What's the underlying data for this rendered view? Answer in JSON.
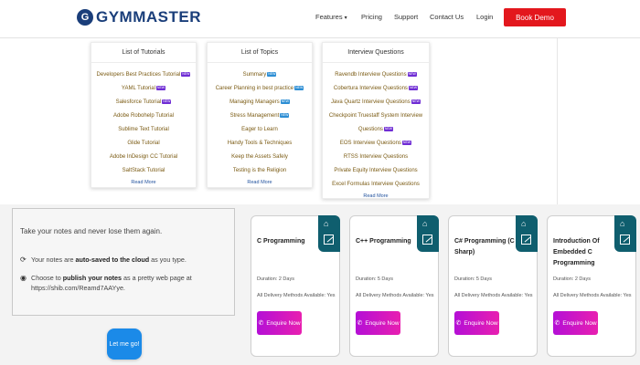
{
  "header": {
    "logo_mark": "G",
    "logo_text": "GYMMASTER",
    "nav": [
      "Features",
      "Pricing",
      "Support",
      "Contact Us",
      "Login"
    ],
    "book_demo": "Book Demo"
  },
  "columns": [
    {
      "title": "List of Tutorials",
      "items": [
        {
          "label": "Developers Best Practices Tutorial",
          "badge": "NEW"
        },
        {
          "label": "YAML Tutorial",
          "badge": "NEW"
        },
        {
          "label": "Salesforce Tutorial",
          "badge": "NEW"
        },
        {
          "label": "Adobe Robohelp Tutorial",
          "badge": ""
        },
        {
          "label": "Sublime Text Tutorial",
          "badge": ""
        },
        {
          "label": "Glide Tutorial",
          "badge": ""
        },
        {
          "label": "Adobe InDesign CC Tutorial",
          "badge": ""
        },
        {
          "label": "SaltStack Tutorial",
          "badge": ""
        }
      ],
      "read_more": "Read More"
    },
    {
      "title": "List of Topics",
      "items": [
        {
          "label": "Summary",
          "badge": "NEW"
        },
        {
          "label": "Career Planning in best practice",
          "badge": "NEW"
        },
        {
          "label": "Managing Managers",
          "badge": "NEW"
        },
        {
          "label": "Stress Management",
          "badge": "NEW"
        },
        {
          "label": "Eager to Learn",
          "badge": ""
        },
        {
          "label": "Handy Tools & Techniques",
          "badge": ""
        },
        {
          "label": "Keep the Assets Safely",
          "badge": ""
        },
        {
          "label": "Testing is the Religion",
          "badge": ""
        }
      ],
      "read_more": "Read More"
    },
    {
      "title": "Interview Questions",
      "items": [
        {
          "label": "Ravendb Interview Questions",
          "badge": "NEW"
        },
        {
          "label": "Cobertura Interview Questions",
          "badge": "NEW"
        },
        {
          "label": "Java Quartz Interview Questions",
          "badge": "NEW"
        },
        {
          "label": "Checkpoint Truestaff System Interview",
          "badge": ""
        },
        {
          "label": "Questions",
          "badge": "NEW"
        },
        {
          "label": "EOS Interview Questions",
          "badge": "NEW"
        },
        {
          "label": "RTSS Interview Questions",
          "badge": ""
        },
        {
          "label": "Private Equity Interview Questions",
          "badge": ""
        },
        {
          "label": "Excel Formulas Interview Questions",
          "badge": ""
        }
      ],
      "read_more": "Read More"
    }
  ],
  "notes": {
    "headline": "Take your notes and never lose them again.",
    "item1_pre": "Your notes are ",
    "item1_bold": "auto-saved to the cloud",
    "item1_post": " as you type.",
    "item2_pre": "Choose to ",
    "item2_bold": "publish your notes",
    "item2_post": " as a pretty web page at",
    "item2_line2": "https://shib.com/Reamd7AAYye.",
    "cta": "Let me go!"
  },
  "courses": [
    {
      "title": "C Programming",
      "duration": "Duration: 2 Days",
      "delivery": "All Delivery Methods Available: Yes",
      "cta": "Enquire Now"
    },
    {
      "title": "C++ Programming",
      "duration": "Duration: 5 Days",
      "delivery": "All Delivery Methods Available: Yes",
      "cta": "Enquire Now"
    },
    {
      "title": "C# Programming (C Sharp)",
      "duration": "Duration: 5 Days",
      "delivery": "All Delivery Methods Available: Yes",
      "cta": "Enquire Now"
    },
    {
      "title": "Introduction Of Embedded C Programming",
      "duration": "Duration: 2 Days",
      "delivery": "All Delivery Methods Available: Yes",
      "cta": "Enquire Now"
    }
  ],
  "colors": {
    "brand": "#1a3e7a",
    "book_demo": "#e3171d",
    "card_tab": "#0f5e6e",
    "enquire": "#d316c8",
    "lets_go": "#1b8ae8"
  }
}
